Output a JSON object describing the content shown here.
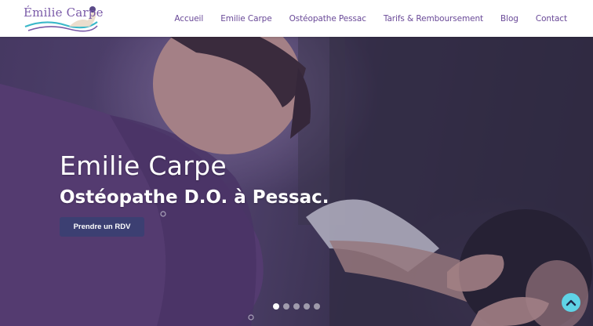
{
  "header": {
    "logo_text": "Émilie Carpe",
    "nav": [
      {
        "label": "Accueil"
      },
      {
        "label": "Emilie Carpe"
      },
      {
        "label": "Ostéopathe Pessac"
      },
      {
        "label": "Tarifs & Remboursement"
      },
      {
        "label": "Blog"
      },
      {
        "label": "Contact"
      }
    ]
  },
  "hero": {
    "title": "Emilie Carpe",
    "subtitle": "Ostéopathe D.O. à Pessac.",
    "cta_label": "Prendre un RDV",
    "slides": 5,
    "active_slide": 1
  },
  "colors": {
    "brand_purple": "#6a4a98",
    "button_navy": "#3c3f72",
    "scroll_top": "#5fd3e6"
  },
  "icons": {
    "scroll_top": "chevron-up-icon",
    "logo": "hands-wave-logo"
  }
}
